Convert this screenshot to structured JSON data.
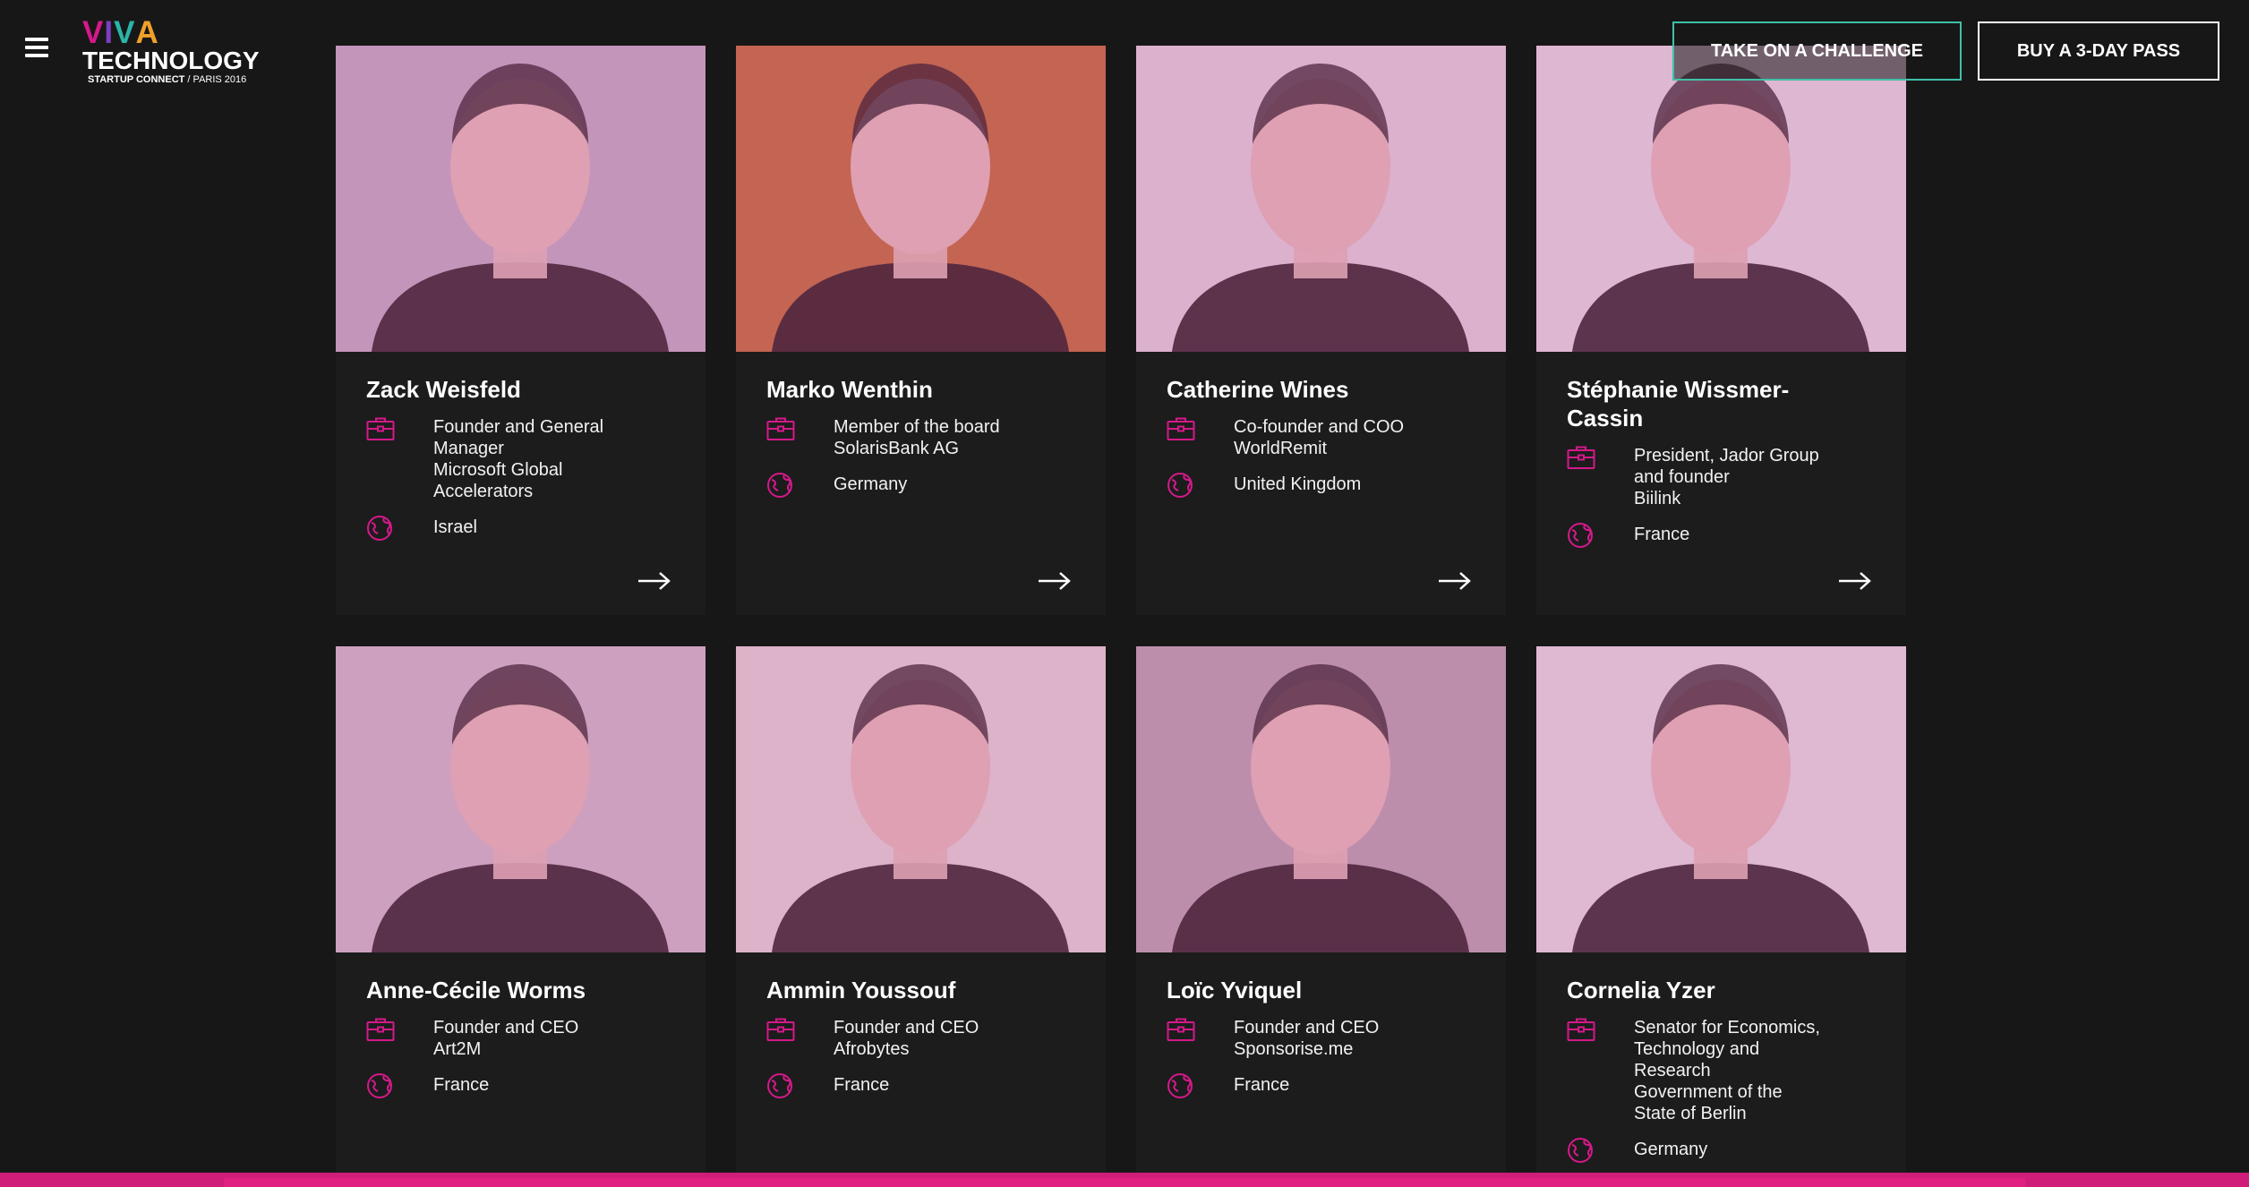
{
  "header": {
    "logo": {
      "line1": [
        "V",
        "I",
        "V",
        "A"
      ],
      "line2": "TECHNOLOGY",
      "sub_bold": "STARTUP CONNECT",
      "sub_rest": " / PARIS 2016"
    },
    "challenge_label": "TAKE ON A CHALLENGE",
    "pass_label": "BUY A 3-DAY PASS"
  },
  "colors": {
    "accent": "#d4198a",
    "challenge_border": "#3fc1a8",
    "background": "#171717",
    "card": "#1c1c1c"
  },
  "speakers": [
    {
      "name": "Zack Weisfeld",
      "role": [
        "Founder and General",
        "Manager",
        "Microsoft Global",
        "Accelerators"
      ],
      "country": "Israel",
      "photo_bg": "#c9aac8",
      "has_arrow": true
    },
    {
      "name": "Marko Wenthin",
      "role": [
        "Member of the board",
        "SolarisBank AG"
      ],
      "country": "Germany",
      "photo_bg": "#c86e4a",
      "has_arrow": true
    },
    {
      "name": "Catherine Wines",
      "role": [
        "Co-founder and COO",
        "WorldRemit"
      ],
      "country": "United Kingdom",
      "photo_bg": "#e4cce0",
      "has_arrow": true
    },
    {
      "name": "Stéphanie Wissmer-Cassin",
      "name_lines": [
        "Stéphanie Wissmer-",
        "Cassin"
      ],
      "role": [
        "President, Jador Group",
        "and founder",
        "Biilink"
      ],
      "country": "France",
      "photo_bg": "#e8d3e6",
      "has_arrow": true
    },
    {
      "name": "Anne-Cécile Worms",
      "role": [
        "Founder and CEO",
        "Art2M"
      ],
      "country": "France",
      "photo_bg": "#d5b8d0",
      "has_arrow": false
    },
    {
      "name": "Ammin Youssouf",
      "role": [
        "Founder and CEO",
        "Afrobytes"
      ],
      "country": "France",
      "photo_bg": "#e6cfd9",
      "has_arrow": false
    },
    {
      "name": "Loïc Yviquel",
      "role": [
        "Founder and CEO",
        "Sponsorise.me"
      ],
      "country": "France",
      "photo_bg": "#c0a2b8",
      "has_arrow": false
    },
    {
      "name": "Cornelia Yzer",
      "role": [
        "Senator for Economics,",
        "Technology and",
        "Research",
        "Government of the",
        "State of Berlin"
      ],
      "country": "Germany",
      "photo_bg": "#ead5e6",
      "has_arrow": false
    }
  ]
}
